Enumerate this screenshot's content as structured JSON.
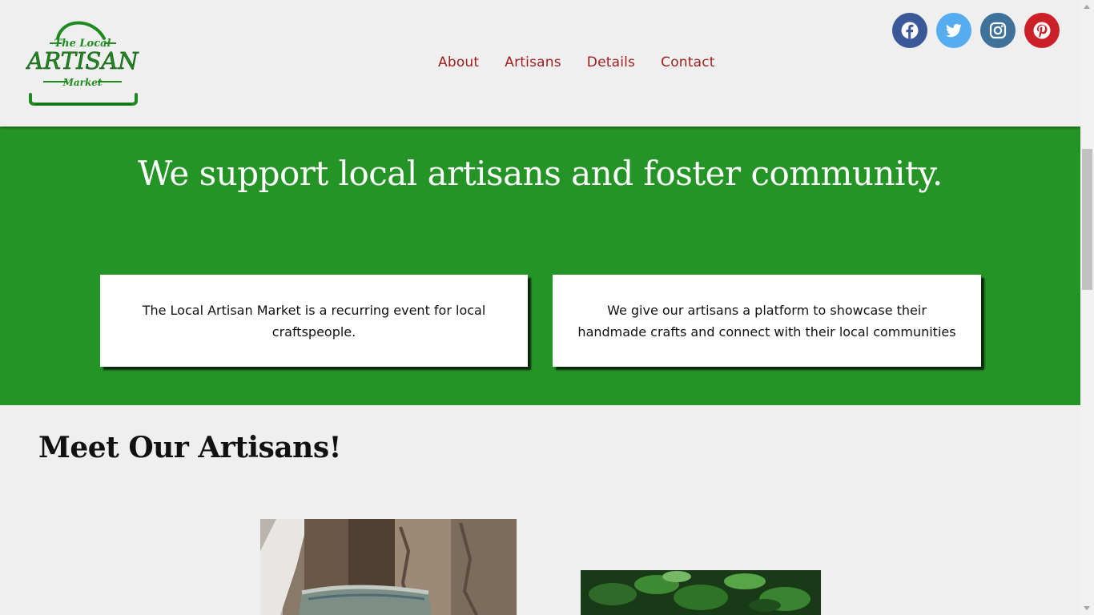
{
  "header": {
    "logo": {
      "line1": "The Local",
      "line2": "ARTISAN",
      "line3": "Market"
    },
    "nav": [
      {
        "label": "About"
      },
      {
        "label": "Artisans"
      },
      {
        "label": "Details"
      },
      {
        "label": "Contact"
      }
    ],
    "socials": [
      {
        "name": "facebook-icon",
        "color": "#3b5998"
      },
      {
        "name": "twitter-icon",
        "color": "#55acee"
      },
      {
        "name": "instagram-icon",
        "color": "#3f729b"
      },
      {
        "name": "pinterest-icon",
        "color": "#cb2027"
      }
    ]
  },
  "hero": {
    "title": "We support local artisans and foster community.",
    "cards": [
      {
        "text": "The Local Artisan Market is a recurring event for local craftspeople."
      },
      {
        "text": "We give our artisans a platform to showcase their handmade crafts and connect with their local communities"
      }
    ]
  },
  "meet": {
    "title": "Meet Our Artisans!"
  },
  "colors": {
    "brand_green": "#259426",
    "nav_red": "#a01e1e",
    "logo_green": "#1f8a1f"
  }
}
